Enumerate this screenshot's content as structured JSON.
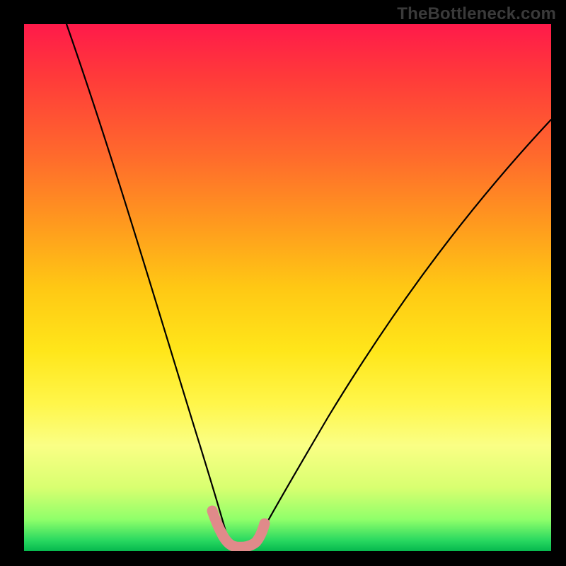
{
  "watermark": "TheBottleneck.com",
  "chart_data": {
    "type": "line",
    "title": "",
    "xlabel": "",
    "ylabel": "",
    "xlim": [
      0,
      100
    ],
    "ylim": [
      0,
      100
    ],
    "series": [
      {
        "name": "bottleneck-curve-left",
        "x": [
          8,
          12,
          16,
          20,
          24,
          28,
          31,
          33.5,
          35.5,
          37,
          38
        ],
        "y": [
          100,
          84,
          67,
          50,
          34,
          20,
          10,
          5,
          2.5,
          1.2,
          0.5
        ]
      },
      {
        "name": "bottleneck-curve-right",
        "x": [
          43,
          46,
          50,
          55,
          62,
          70,
          80,
          90,
          100
        ],
        "y": [
          0.5,
          4,
          10,
          19,
          33,
          48,
          62,
          74,
          82
        ]
      }
    ],
    "markers": {
      "name": "highlight-band",
      "color": "#e08a8a",
      "points_x": [
        35.3,
        35.8,
        36.5,
        37.5,
        39,
        41,
        42.5,
        43.3,
        44,
        44.5
      ],
      "points_y": [
        7,
        5,
        3.5,
        2,
        1,
        1,
        1.3,
        2.2,
        3.5,
        5
      ]
    },
    "background_gradient": {
      "from": "#ff1a4a",
      "to": "#06b84e",
      "direction": "top-to-bottom"
    }
  }
}
